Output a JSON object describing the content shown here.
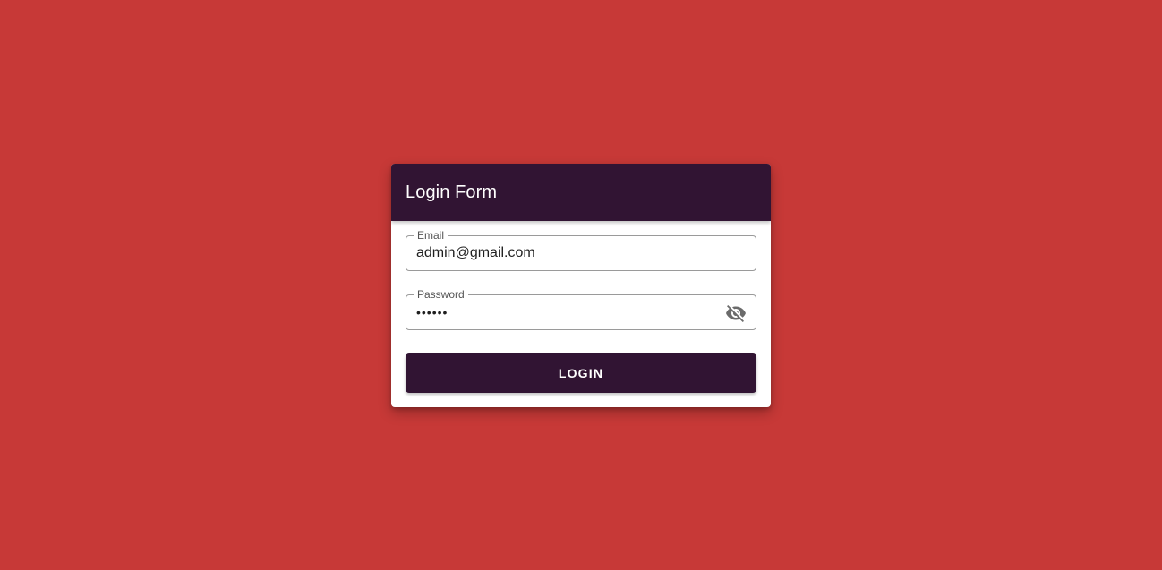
{
  "colors": {
    "background": "#c73937",
    "primary": "#311433",
    "card": "#ffffff"
  },
  "login_form": {
    "title": "Login Form",
    "email": {
      "label": "Email",
      "value": "admin@gmail.com"
    },
    "password": {
      "label": "Password",
      "value": "••••••",
      "toggle_icon": "visibility-off-icon"
    },
    "submit_label": "LOGIN"
  }
}
